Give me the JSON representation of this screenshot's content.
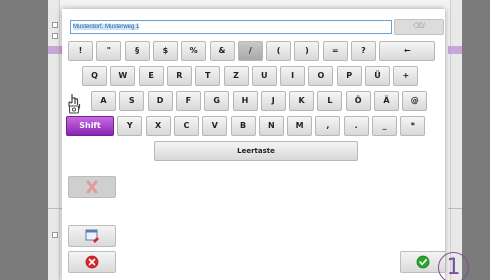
{
  "input": {
    "value": "Musterdorf, Musterweg 1"
  },
  "clear_button": {
    "label": "⌫/"
  },
  "keyboard": {
    "row1": [
      "!",
      "\"",
      "§",
      "$",
      "%",
      "&",
      "/",
      "(",
      ")",
      "=",
      "?",
      "←"
    ],
    "row2": [
      "Q",
      "W",
      "E",
      "R",
      "T",
      "Z",
      "U",
      "I",
      "O",
      "P",
      "Ü",
      "+"
    ],
    "row3": [
      "A",
      "S",
      "D",
      "F",
      "G",
      "H",
      "J",
      "K",
      "L",
      "Ö",
      "Ä",
      "@"
    ],
    "row4": [
      "Shift",
      "Y",
      "X",
      "C",
      "V",
      "B",
      "N",
      "M",
      ",",
      ".",
      "_",
      "*"
    ],
    "space": "Leertaste"
  },
  "step_marker": "1",
  "colors": {
    "shift": "#8b25b2",
    "input_text": "#1d5fa8",
    "ok_green": "#2aa52a",
    "cancel_red": "#d8262b"
  }
}
